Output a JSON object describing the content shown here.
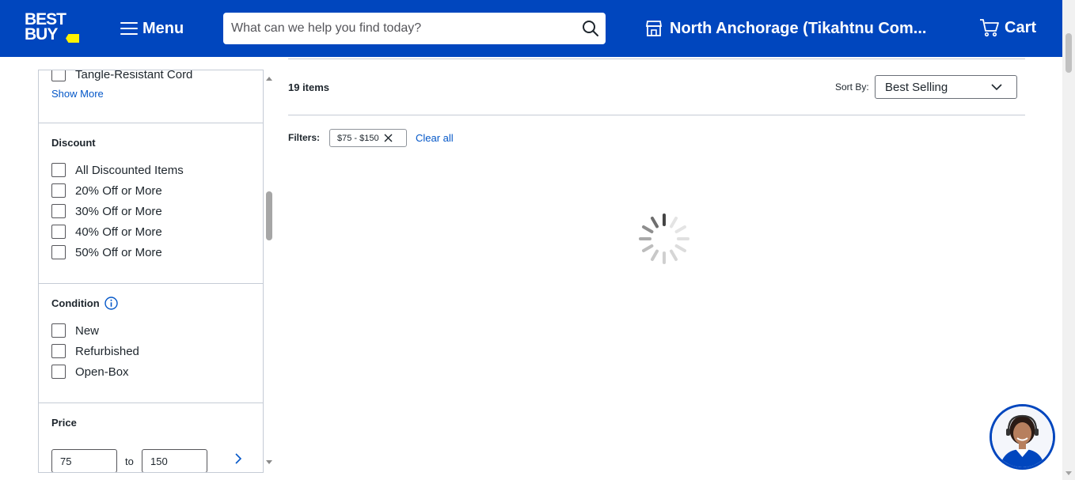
{
  "header": {
    "logo_text_line1": "BEST",
    "logo_text_line2": "BUY",
    "menu_label": "Menu",
    "search_placeholder": "What can we help you find today?",
    "store_label": "North Anchorage (Tikahtnu Com...",
    "cart_label": "Cart",
    "brand_color": "#0046be",
    "tag_color": "#fff200"
  },
  "sidebar": {
    "features_partial": {
      "items": [
        "Tangle-Resistant Cord"
      ],
      "show_more": "Show More"
    },
    "discount": {
      "title": "Discount",
      "options": [
        "All Discounted Items",
        "20% Off or More",
        "30% Off or More",
        "40% Off or More",
        "50% Off or More"
      ]
    },
    "condition": {
      "title": "Condition",
      "options": [
        "New",
        "Refurbished",
        "Open-Box"
      ]
    },
    "price": {
      "title": "Price",
      "min": "75",
      "to_label": "to",
      "max": "150"
    }
  },
  "results": {
    "count": "19 items",
    "sort_label": "Sort By:",
    "sort_value": "Best Selling",
    "filters_label": "Filters:",
    "active_filter": "$75 - $150",
    "clear_all": "Clear all",
    "loading": true
  },
  "link_color": "#0457c8"
}
